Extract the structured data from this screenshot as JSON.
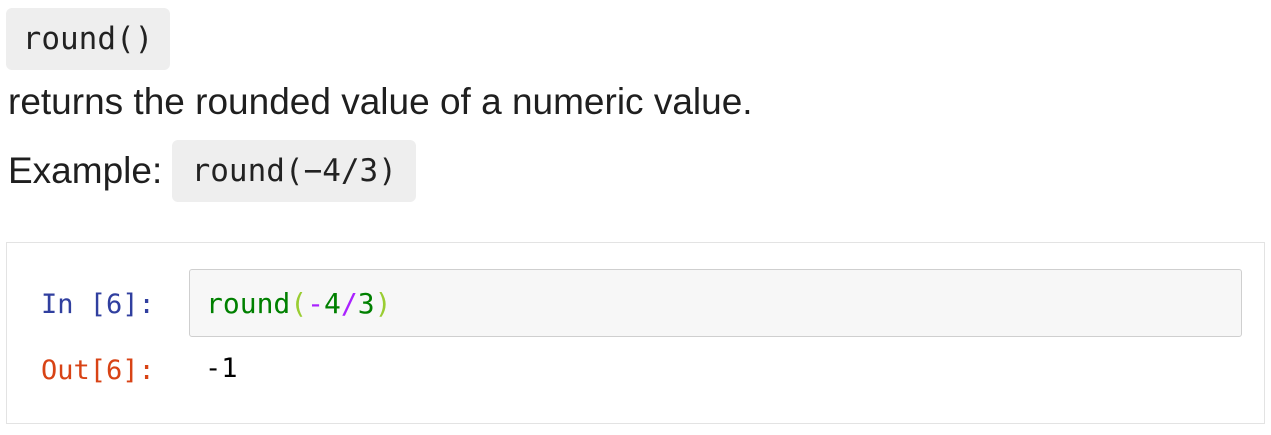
{
  "doc": {
    "function_name": "round()",
    "description": "returns the rounded value of a numeric value.",
    "example_label": "Example:",
    "example_code": "round(−4/3)"
  },
  "cell": {
    "in_prompt": "In [6]:",
    "out_prompt": "Out[6]:",
    "code_tokens": {
      "builtin": "round",
      "open_paren": "(",
      "minus": "-",
      "num1": "4",
      "slash": "/",
      "num2": "3",
      "close_paren": ")"
    },
    "output": "-1"
  },
  "colors": {
    "in_prompt": "#303f9f",
    "out_prompt": "#d84315",
    "builtin": "#008000",
    "operator": "#aa22ff",
    "chip_bg": "#eeeeee"
  }
}
